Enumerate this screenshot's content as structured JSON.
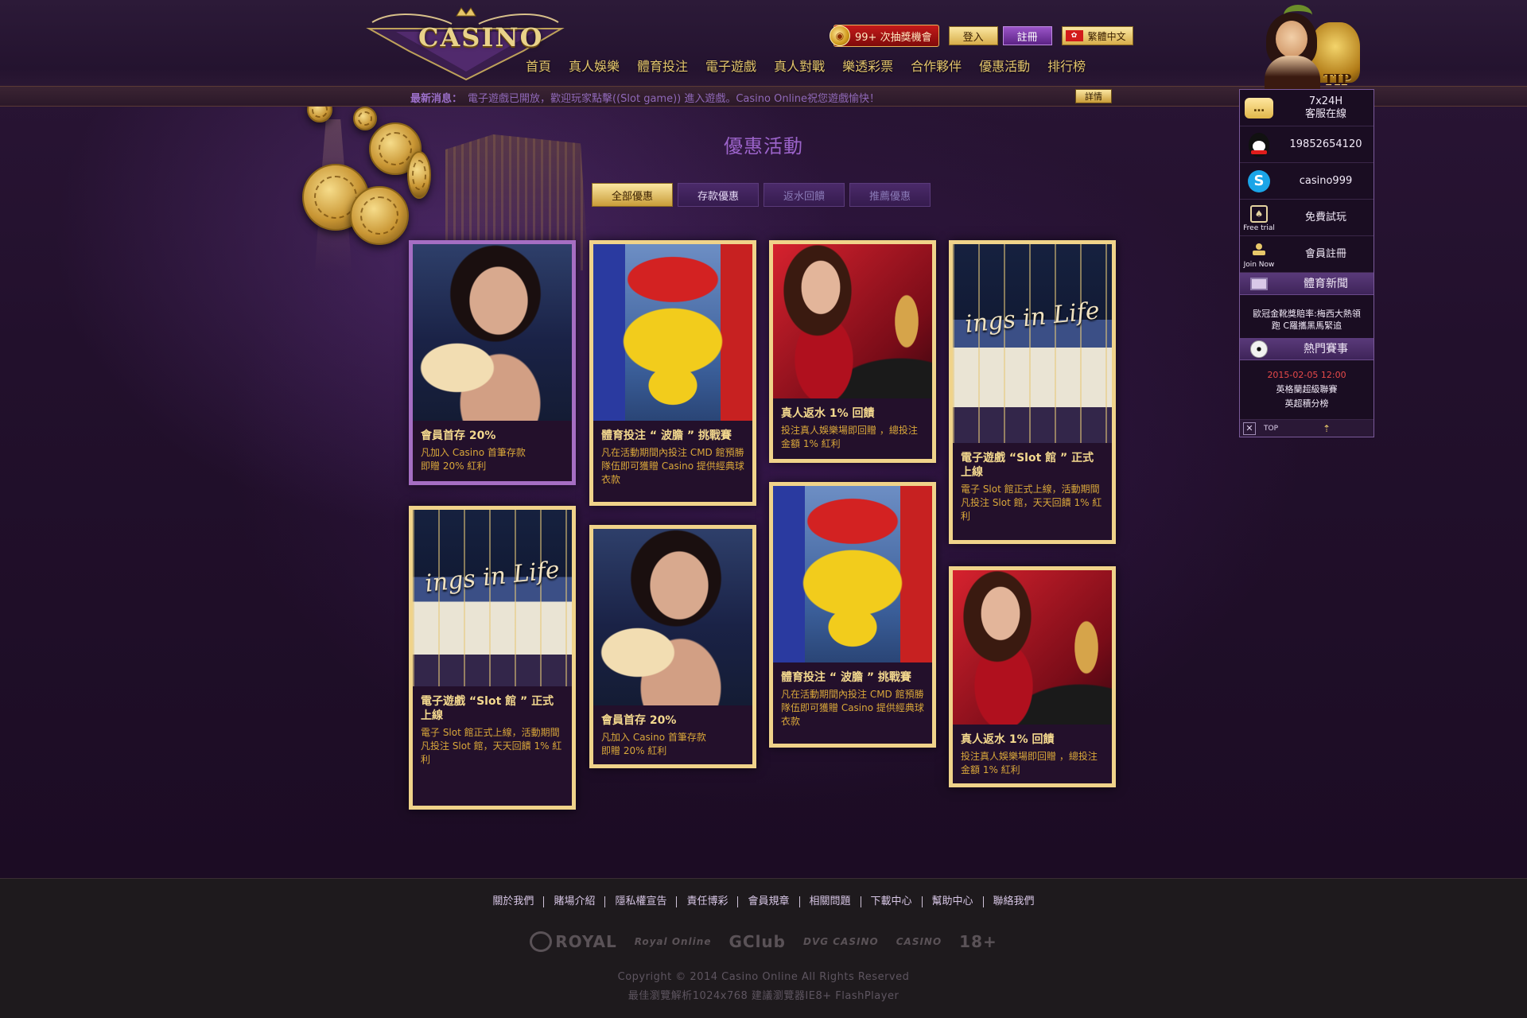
{
  "header": {
    "logo_text": "CASINO",
    "lottery_label": "99+ 次抽獎機會",
    "login_label": "登入",
    "register_label": "註冊",
    "language_label": "繁體中文",
    "nav": [
      "首頁",
      "真人娛樂",
      "體育投注",
      "電子遊戲",
      "真人對戰",
      "樂透彩票",
      "合作夥伴",
      "優惠活動",
      "排行榜"
    ]
  },
  "ticker": {
    "label": "最新消息：",
    "text": "電子遊戲已開放，歡迎玩家點擊((Slot game)) 進入遊戲。Casino Online祝您遊戲愉快！",
    "details_label": "詳情"
  },
  "main": {
    "title": "優惠活動",
    "tabs": [
      "全部優惠",
      "存款優惠",
      "返水回饋",
      "推薦優惠"
    ],
    "cards": [
      {
        "title": "會員首存 20%",
        "desc": "凡加入 Casino 首筆存款\n即贈 20% 紅利"
      },
      {
        "title": "體育投注 “ 波膽 ” 挑戰賽",
        "desc": "凡在活動期間內投注 CMD 館預勝隊伍即可獲贈 Casino 提供經典球衣款"
      },
      {
        "title": "真人返水 1% 回饋",
        "desc": "投注真人娛樂場即回贈 ，總投注金額 1% 紅利"
      },
      {
        "title": "電子遊戲 “Slot 館 ” 正式上線",
        "desc": "電子 Slot 館正式上線，活動期間凡投注 Slot 館，天天回饋 1% 紅利"
      },
      {
        "title": "電子遊戲 “Slot 館 ” 正式上線",
        "desc": "電子 Slot 館正式上線，活動期間凡投注 Slot 館，天天回饋 1% 紅利"
      },
      {
        "title": "會員首存 20%",
        "desc": "凡加入 Casino 首筆存款\n即贈 20% 紅利"
      },
      {
        "title": "體育投注 “ 波膽 ” 挑戰賽",
        "desc": "凡在活動期間內投注 CMD 館預勝隊伍即可獲贈 Casino 提供經典球衣款"
      },
      {
        "title": "真人返水 1% 回饋",
        "desc": "投注真人娛樂場即回贈 ，總投注金額 1% 紅利"
      }
    ],
    "slot_caption": "ings in Life"
  },
  "float_widget": {
    "tip_label": "TIP",
    "service_hours": "7x24H",
    "service_label": "客服在線",
    "qq": "19852654120",
    "skype": "casino999",
    "free_trial_caption": "Free trial",
    "free_trial_label": "免費試玩",
    "join_caption": "Join Now",
    "join_label": "會員註冊",
    "sports_news_header": "體育新聞",
    "sports_news_text": "歐冠金靴獎賠率:梅西大熱領跑 C羅攜黑馬緊追",
    "hot_matches_header": "熱門賽事",
    "match_date": "2015-02-05 12:00",
    "match_league": "英格蘭超級聯賽",
    "match_name": "英超積分榜",
    "top_label": "TOP"
  },
  "footer": {
    "links": [
      "關於我們",
      "賭場介紹",
      "隱私權宣告",
      "責任博彩",
      "會員規章",
      "相關問題",
      "下載中心",
      "幫助中心",
      "聯絡我們"
    ],
    "partners": [
      "ROYAL",
      "Royal Online",
      "GClub",
      "DVG CASINO",
      "CASINO",
      "18+"
    ],
    "copyright": "Copyright © 2014 Casino Online All Rights Reserved",
    "best_view": "最佳瀏覽解析1024x768 建議瀏覽器IE8+ FlashPlayer"
  }
}
